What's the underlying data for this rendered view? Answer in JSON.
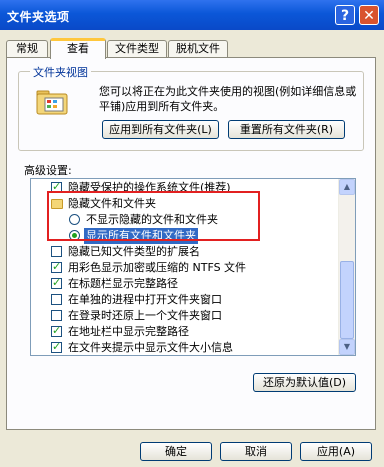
{
  "window": {
    "title": "文件夹选项",
    "help_glyph": "?",
    "close_glyph": "✕"
  },
  "tabs": [
    {
      "label": "常规",
      "active": false
    },
    {
      "label": "查看",
      "active": true
    },
    {
      "label": "文件类型",
      "active": false
    },
    {
      "label": "脱机文件",
      "active": false
    }
  ],
  "folder_views": {
    "title": "文件夹视图",
    "description": "您可以将正在为此文件夹使用的视图(例如详细信息或平铺)应用到所有文件夹。",
    "apply_all_label": "应用到所有文件夹(L)",
    "reset_all_label": "重置所有文件夹(R)"
  },
  "advanced": {
    "label": "高级设置:",
    "items": [
      {
        "type": "checkbox",
        "checked": true,
        "label": "隐藏受保护的操作系统文件(推荐)"
      },
      {
        "type": "folder",
        "label": "隐藏文件和文件夹"
      },
      {
        "type": "radio",
        "selected": false,
        "label": "不显示隐藏的文件和文件夹"
      },
      {
        "type": "radio",
        "selected": true,
        "label": "显示所有文件和文件夹"
      },
      {
        "type": "checkbox",
        "checked": false,
        "label": "隐藏已知文件类型的扩展名"
      },
      {
        "type": "checkbox",
        "checked": true,
        "label": "用彩色显示加密或压缩的 NTFS 文件"
      },
      {
        "type": "checkbox",
        "checked": true,
        "label": "在标题栏显示完整路径"
      },
      {
        "type": "checkbox",
        "checked": false,
        "label": "在单独的进程中打开文件夹窗口"
      },
      {
        "type": "checkbox",
        "checked": false,
        "label": "在登录时还原上一个文件夹窗口"
      },
      {
        "type": "checkbox",
        "checked": true,
        "label": "在地址栏中显示完整路径"
      },
      {
        "type": "checkbox",
        "checked": true,
        "label": "在文件夹提示中显示文件大小信息"
      }
    ],
    "restore_defaults_label": "还原为默认值(D)"
  },
  "footer": {
    "ok_label": "确定",
    "cancel_label": "取消",
    "apply_label": "应用(A)"
  },
  "colors": {
    "title_bar": "#0b57d8",
    "highlight": "#316ac5",
    "annotation_box": "#e22020",
    "check": "#21a121"
  }
}
